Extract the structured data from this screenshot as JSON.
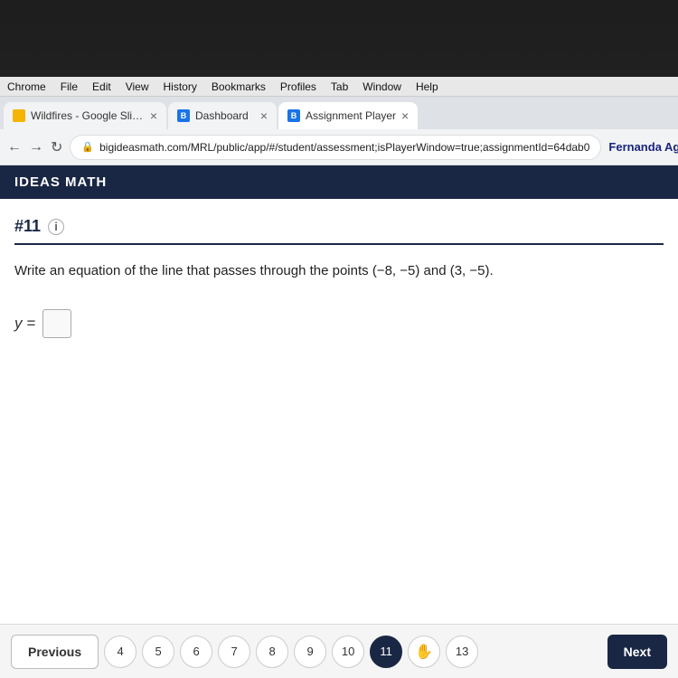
{
  "laptop_top": {
    "visible": true
  },
  "menu_bar": {
    "items": [
      "Chrome",
      "File",
      "Edit",
      "View",
      "History",
      "Bookmarks",
      "Profiles",
      "Tab",
      "Window",
      "Help"
    ]
  },
  "tabs": [
    {
      "id": "slides",
      "label": "Wildfires - Google Slides",
      "type": "slides",
      "active": false
    },
    {
      "id": "dashboard",
      "label": "Dashboard",
      "type": "bigideas",
      "active": false
    },
    {
      "id": "assignment",
      "label": "Assignment Player",
      "type": "bigideas",
      "active": true
    }
  ],
  "address_bar": {
    "url": "bigideasmath.com/MRL/public/app/#/student/assessment;isPlayerWindow=true;assignmentId=64dab0",
    "lock_icon": "🔒"
  },
  "user": {
    "name": "Fernanda Aguilar-Alonso"
  },
  "ideas_math": {
    "title": "IDEAS MATH"
  },
  "question": {
    "number": "#11",
    "info": "i",
    "text": "Write an equation of the line that passes through the points (−8, −5) and (3, −5).",
    "answer_prefix": "y =",
    "answer_placeholder": ""
  },
  "bottom_nav": {
    "previous_label": "Previous",
    "next_label": "Next",
    "page_numbers": [
      {
        "value": "4",
        "active": false
      },
      {
        "value": "5",
        "active": false
      },
      {
        "value": "6",
        "active": false
      },
      {
        "value": "7",
        "active": false
      },
      {
        "value": "8",
        "active": false
      },
      {
        "value": "9",
        "active": false
      },
      {
        "value": "10",
        "active": false
      },
      {
        "value": "11",
        "active": true
      },
      {
        "value": "✋",
        "active": false,
        "special": true
      },
      {
        "value": "13",
        "active": false
      }
    ]
  }
}
